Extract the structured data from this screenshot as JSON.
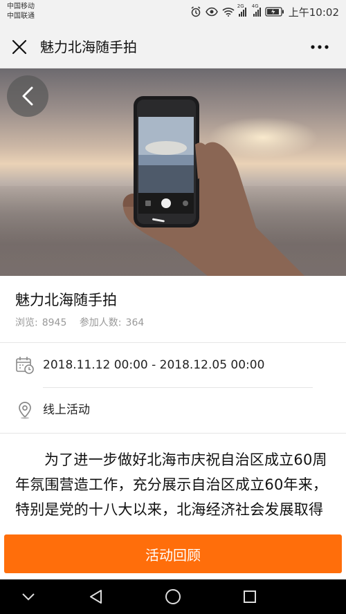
{
  "status_bar": {
    "carrier_1": "中国移动",
    "carrier_2": "中国联通",
    "signal_1_label": "2G",
    "signal_2_label": "4G",
    "time": "上午10:02"
  },
  "nav": {
    "title": "魅力北海随手拍",
    "close_icon": "close-icon",
    "more_icon": "more-dots-icon"
  },
  "hero": {
    "image": "hand holding phone photographing sunset over sea",
    "back_icon": "chevron-left-icon"
  },
  "event": {
    "title": "魅力北海随手拍",
    "views_label": "浏览:",
    "views_value": "8945",
    "participants_label": "参加人数:",
    "participants_value": "364",
    "date_range": "2018.11.12 00:00 - 2018.12.05 00:00",
    "location": "线上活动",
    "description": "为了进一步做好北海市庆祝自治区成立60周年氛围营造工作，充分展示自治区成立60年来，特别是党的十八大以来，北海经济社会发展取得的巨大成就，巨大城市作和全市人民风"
  },
  "cta": {
    "label": "活动回顾",
    "color": "#ff6e0b"
  }
}
